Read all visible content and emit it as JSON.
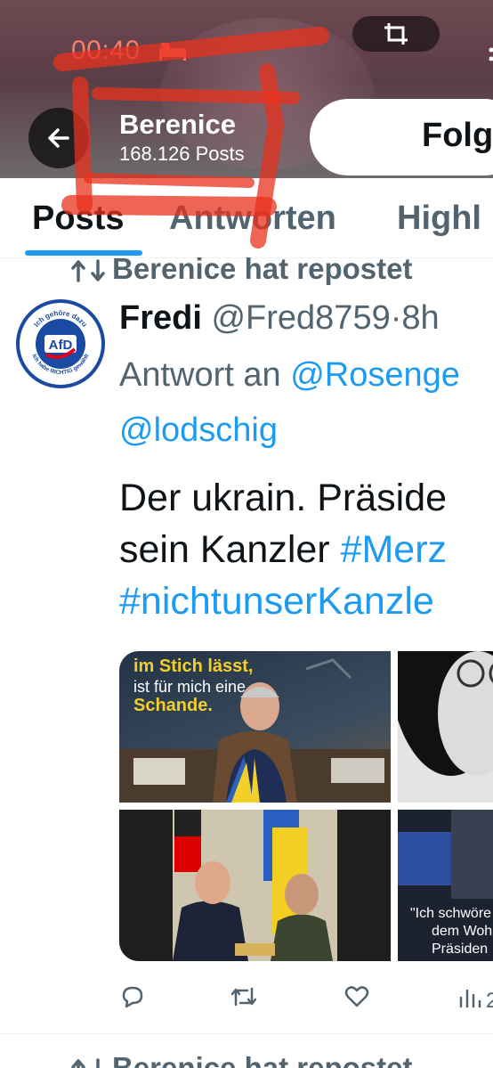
{
  "status": {
    "time": "00:40"
  },
  "header": {
    "name": "Berenice",
    "posts_count": "168.126 Posts",
    "follow_label": "Folg"
  },
  "tabs": [
    {
      "label": "Posts",
      "active": true
    },
    {
      "label": "Antworten",
      "active": false
    },
    {
      "label": "Highl",
      "active": false
    }
  ],
  "tweet": {
    "repost_label": "Berenice hat repostet",
    "author_name": "Fredi",
    "author_handle": "@Fred8759",
    "time": "·8h",
    "reply_prefix": "Antwort an",
    "reply_mention_1": "@Rosenge",
    "reply_mention_2": "@lodschig",
    "text_line_1": "Der ukrain. Präside",
    "text_line_2_plain": "sein Kanzler ",
    "text_line_2_hashtag": "#Merz",
    "text_line_3_hashtag": "#nichtunserKanzle",
    "avatar_text_top": "Ich gehöre dazu",
    "avatar_text_center": "AfD",
    "avatar_text_bottom": "Ich habe RICHTIG gewählt",
    "media": {
      "caption_1a": "im Stich lässt,",
      "caption_1b": "ist für mich eine",
      "caption_1c": "Schande.",
      "caption_4a": "\"Ich schwöre",
      "caption_4b": "dem Woh",
      "caption_4c": "Präsiden"
    },
    "views_count": "2"
  },
  "next_item": {
    "repost_label": "Berenice hat repostet"
  },
  "colors": {
    "accent": "#1d9bf0",
    "text": "#0f1419",
    "muted": "#536471",
    "status_time": "#ff7a6b"
  }
}
